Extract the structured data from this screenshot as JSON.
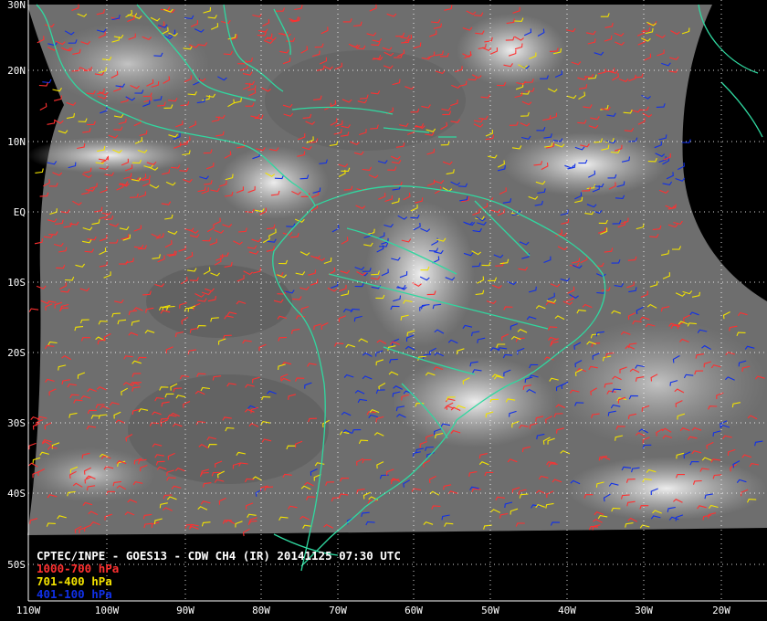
{
  "caption": {
    "title": "CPTEC/INPE - GOES13 - CDW CH4 (IR) 20141125 07:30 UTC",
    "legend": [
      {
        "label": "1000-700 hPa",
        "color": "#ff3030"
      },
      {
        "label": "701-400 hPa",
        "color": "#f2e200"
      },
      {
        "label": "401-100 hPa",
        "color": "#1030e8"
      }
    ]
  },
  "axes": {
    "lat_labels": [
      "30N",
      "20N",
      "10N",
      "EQ",
      "10S",
      "20S",
      "30S",
      "40S",
      "50S"
    ],
    "lon_labels": [
      "110W",
      "100W",
      "90W",
      "80W",
      "70W",
      "60W",
      "50W",
      "40W",
      "30W",
      "20W"
    ]
  },
  "colors": {
    "coastline": "#30d8a0",
    "grid": "#ffffff",
    "background": "#000000"
  }
}
